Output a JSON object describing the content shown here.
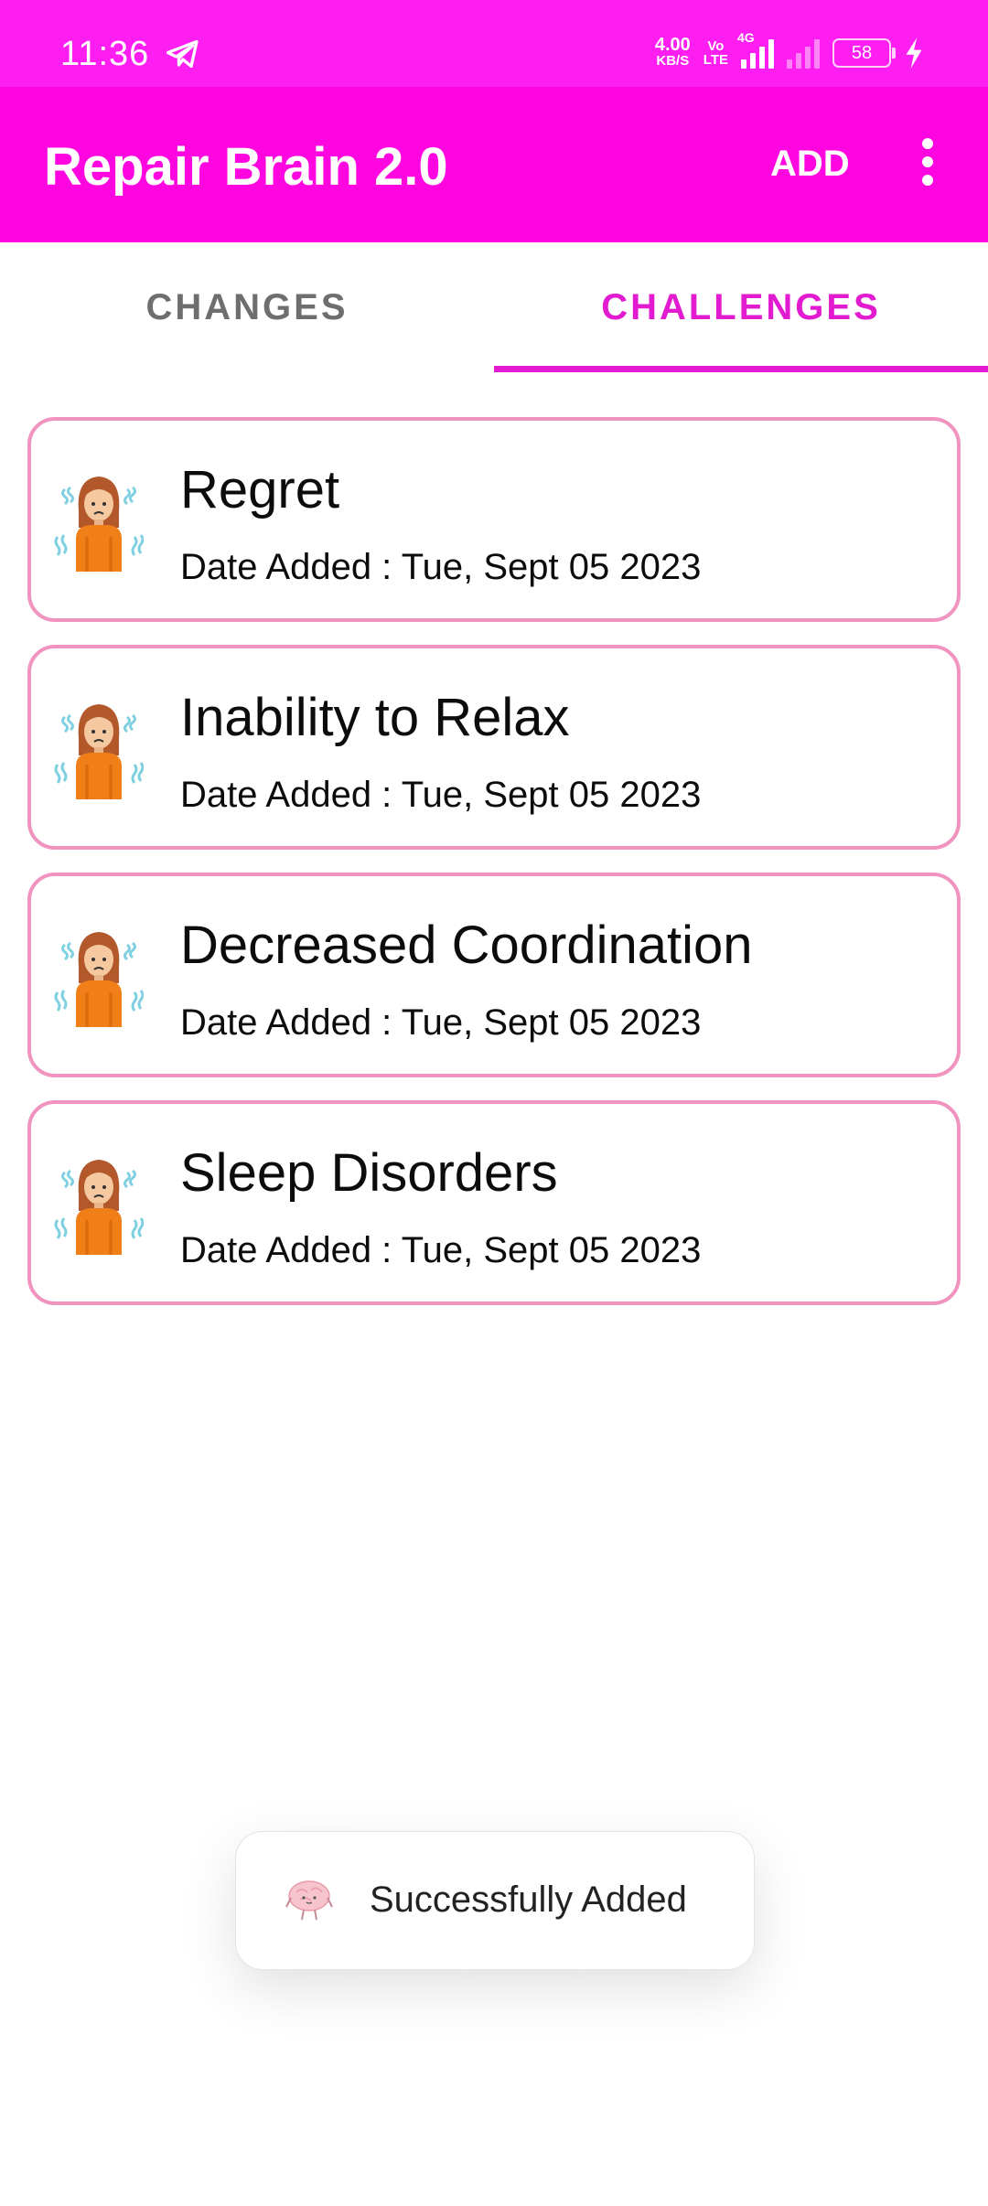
{
  "status_bar": {
    "time": "11:36",
    "net_speed": "4.00",
    "net_speed_unit": "KB/S",
    "volte_top": "Vo",
    "volte_bottom": "LTE",
    "network_type": "4G",
    "battery_level": "58",
    "icons": [
      "telegram-icon",
      "signal-icon",
      "signal-icon-dim",
      "battery-icon",
      "charging-bolt-icon"
    ]
  },
  "app_bar": {
    "title": "Repair Brain 2.0",
    "add_label": "ADD",
    "menu_icon": "more-vert-icon"
  },
  "tabs": [
    {
      "label": "CHANGES",
      "selected": false
    },
    {
      "label": "CHALLENGES",
      "selected": true
    }
  ],
  "challenges": [
    {
      "title": "Regret",
      "date_label": "Date Added :",
      "date": "Tue, Sept 05 2023",
      "icon": "shivering-woman-icon"
    },
    {
      "title": "Inability to Relax",
      "date_label": "Date Added :",
      "date": "Tue, Sept 05 2023",
      "icon": "shivering-woman-icon"
    },
    {
      "title": "Decreased Coordination",
      "date_label": "Date Added :",
      "date": "Tue, Sept 05 2023",
      "icon": "shivering-woman-icon"
    },
    {
      "title": "Sleep Disorders",
      "date_label": "Date Added :",
      "date": "Tue, Sept 05 2023",
      "icon": "shivering-woman-icon"
    }
  ],
  "toast": {
    "message": "Successfully Added",
    "icon": "brain-icon"
  },
  "colors": {
    "status_bar": "#ff1ef2",
    "app_bar": "#ff05df",
    "accent": "#e21bd1",
    "card_border": "#f093bf"
  }
}
